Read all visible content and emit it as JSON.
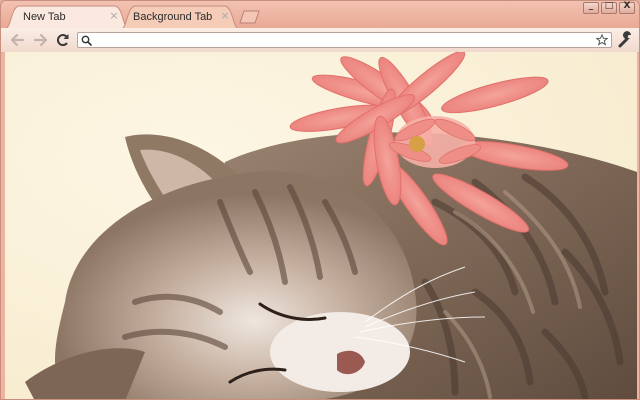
{
  "tabs": [
    {
      "title": "New Tab",
      "active": true
    },
    {
      "title": "Background Tab",
      "active": false
    }
  ],
  "omnibox": {
    "value": "",
    "placeholder": ""
  },
  "window_controls": {
    "minimize": "_",
    "maximize": "□",
    "close": "X"
  },
  "icons": {
    "back": "back-arrow-icon",
    "forward": "forward-arrow-icon",
    "reload": "reload-icon",
    "search": "search-icon",
    "bookmark": "star-icon",
    "wrench": "wrench-icon",
    "close_tab": "close-icon"
  },
  "colors": {
    "theme_frame": "#eeb3a1",
    "tab_active": "#fbe9df",
    "content_bg": "#fcf3df",
    "flower": "#f08c86"
  }
}
